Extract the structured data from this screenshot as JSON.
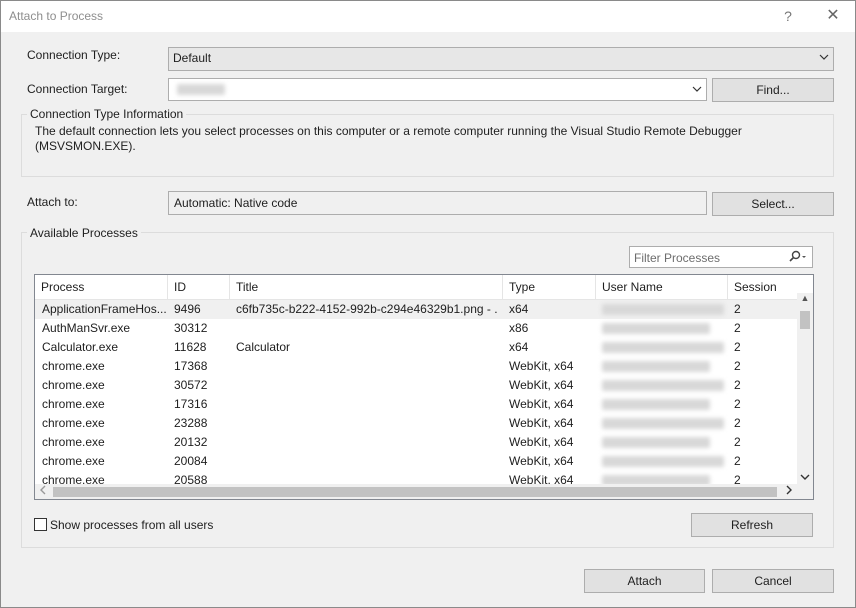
{
  "window": {
    "title": "Attach to Process",
    "help_glyph": "?",
    "close_glyph": "✕"
  },
  "connection": {
    "type_label": "Connection Type:",
    "type_value": "Default",
    "target_label": "Connection Target:",
    "find_button": "Find..."
  },
  "info": {
    "title": "Connection Type Information",
    "text": "The default connection lets you select processes on this computer or a remote computer running the Visual Studio Remote Debugger (MSVSMON.EXE)."
  },
  "attach_to": {
    "label": "Attach to:",
    "value": "Automatic: Native code",
    "select_button": "Select..."
  },
  "processes": {
    "group_title": "Available Processes",
    "filter_placeholder": "Filter Processes",
    "columns": [
      "Process",
      "ID",
      "Title",
      "Type",
      "User Name",
      "Session"
    ],
    "rows": [
      {
        "process": "ApplicationFrameHos...",
        "id": "9496",
        "title": "c6fb735c-b222-4152-992b-c294e46329b1.png - ...",
        "type": "x64",
        "session": "2"
      },
      {
        "process": "AuthManSvr.exe",
        "id": "30312",
        "title": "",
        "type": "x86",
        "session": "2"
      },
      {
        "process": "Calculator.exe",
        "id": "11628",
        "title": "Calculator",
        "type": "x64",
        "session": "2"
      },
      {
        "process": "chrome.exe",
        "id": "17368",
        "title": "",
        "type": "WebKit, x64",
        "session": "2"
      },
      {
        "process": "chrome.exe",
        "id": "30572",
        "title": "",
        "type": "WebKit, x64",
        "session": "2"
      },
      {
        "process": "chrome.exe",
        "id": "17316",
        "title": "",
        "type": "WebKit, x64",
        "session": "2"
      },
      {
        "process": "chrome.exe",
        "id": "23288",
        "title": "",
        "type": "WebKit, x64",
        "session": "2"
      },
      {
        "process": "chrome.exe",
        "id": "20132",
        "title": "",
        "type": "WebKit, x64",
        "session": "2"
      },
      {
        "process": "chrome.exe",
        "id": "20084",
        "title": "",
        "type": "WebKit, x64",
        "session": "2"
      },
      {
        "process": "chrome.exe",
        "id": "20588",
        "title": "",
        "type": "WebKit, x64",
        "session": "2"
      }
    ],
    "show_all_users_label": "Show processes from all users",
    "refresh_button": "Refresh"
  },
  "footer": {
    "attach_button": "Attach",
    "cancel_button": "Cancel"
  },
  "icons": {
    "dropdown": "chevron-down-icon",
    "search": "search-icon"
  },
  "colors": {
    "selected_row": "#f0f0f0",
    "dialog_bg": "#f0f0f0",
    "button_bg": "#e1e1e1"
  }
}
